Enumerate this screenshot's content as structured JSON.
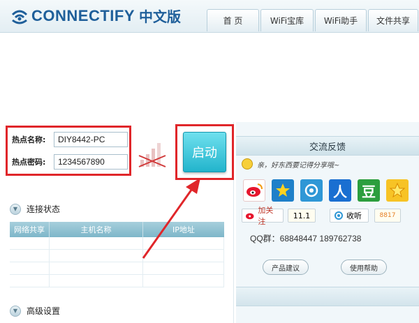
{
  "app": {
    "logo_text": "CONNECTIFY",
    "logo_cn": "中文版",
    "top_right_text": "________"
  },
  "tabs": [
    {
      "label": "首 页"
    },
    {
      "label": "WiFi宝库"
    },
    {
      "label": "WiFi助手"
    },
    {
      "label": "文件共享"
    }
  ],
  "hotspot": {
    "name_label": "热点名称:",
    "name_value": "DIY8442-PC",
    "password_label": "热点密码:",
    "password_value": "1234567890",
    "start_label": "启动"
  },
  "connection": {
    "title": "连接状态",
    "columns": [
      "网络共享",
      "主机名称",
      "IP地址"
    ],
    "rows": 4
  },
  "advanced": {
    "title": "高级设置"
  },
  "feedback": {
    "title": "交流反馈",
    "note": "亲，好东西要记得分享哦~",
    "social_icons": [
      "weibo-icon",
      "star-icon",
      "tencent-weibo-icon",
      "renren-icon",
      "douban-icon",
      "qzone-icon"
    ],
    "follow_label": "加关注",
    "follow_count": "11.1",
    "listen_label": "收听",
    "listen_count": "8817",
    "qq_group": "QQ群：68848447 189762738",
    "suggest_label": "产品建议",
    "help_label": "使用帮助"
  },
  "colors": {
    "brand": "#1f5f9a",
    "highlight": "#e0262a",
    "start_button": "#22b4cc"
  }
}
